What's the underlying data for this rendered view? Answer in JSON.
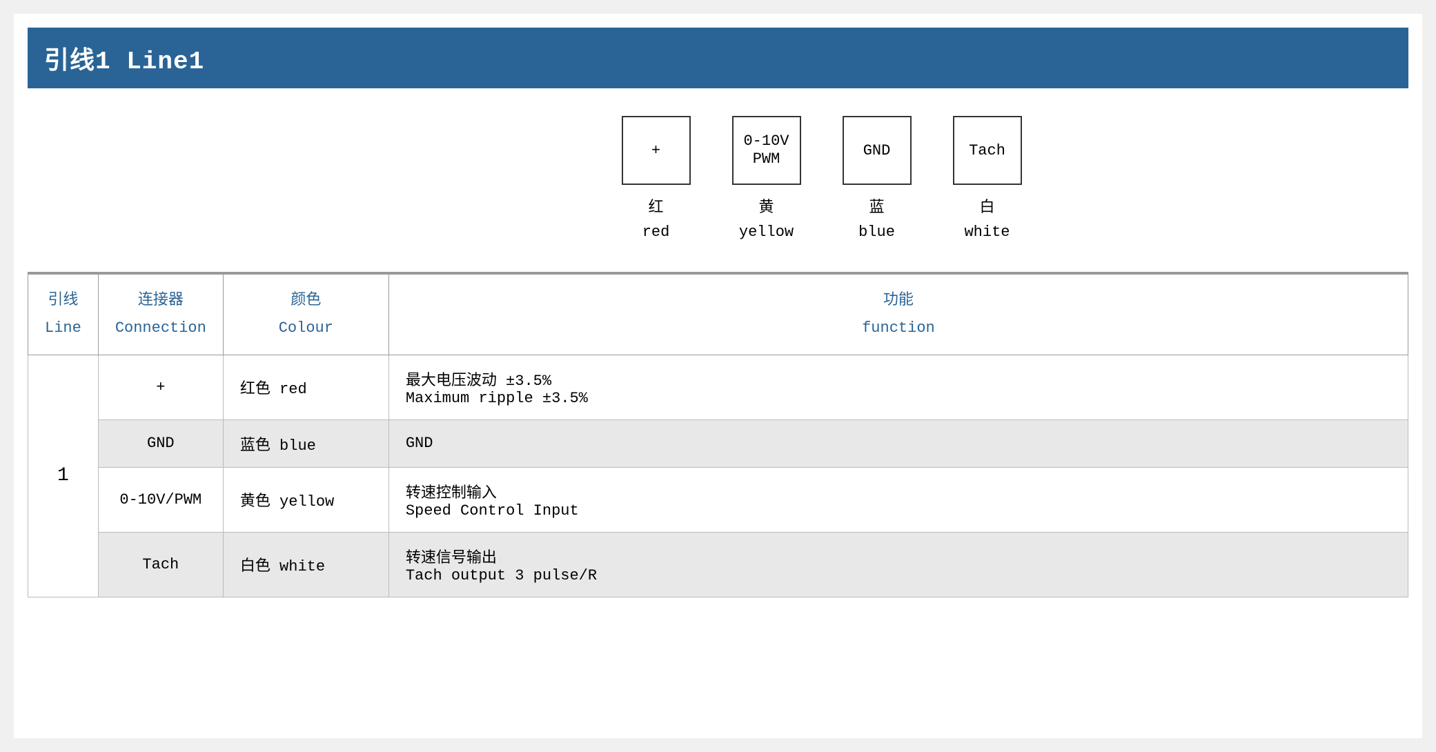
{
  "title": "引线1  Line1",
  "diagram": {
    "connectors": [
      {
        "symbol": "+",
        "chinese": "红",
        "english": "red"
      },
      {
        "symbol_line1": "0-10V",
        "symbol_line2": "PWM",
        "chinese": "黄",
        "english": "yellow"
      },
      {
        "symbol": "GND",
        "chinese": "蓝",
        "english": "blue"
      },
      {
        "symbol": "Tach",
        "chinese": "白",
        "english": "white"
      }
    ]
  },
  "table": {
    "headers": {
      "line_chinese": "引线",
      "line_english": "Line",
      "connection_chinese": "连接器",
      "connection_english": "Connection",
      "colour_chinese": "颜色",
      "colour_english": "Colour",
      "function_chinese": "功能",
      "function_english": "function"
    },
    "rows": [
      {
        "line": "1",
        "connection": "+",
        "colour": "红色 red",
        "function_chinese": "最大电压波动 ±3.5%",
        "function_english": "Maximum ripple ±3.5%",
        "shaded": false
      },
      {
        "line": "",
        "connection": "GND",
        "colour": "蓝色 blue",
        "function_chinese": "GND",
        "function_english": "",
        "shaded": true
      },
      {
        "line": "",
        "connection": "0-10V/PWM",
        "colour": "黄色 yellow",
        "function_chinese": "转速控制输入",
        "function_english": "Speed Control Input",
        "shaded": false
      },
      {
        "line": "",
        "connection": "Tach",
        "colour": "白色 white",
        "function_chinese": "转速信号输出",
        "function_english": "Tach output 3 pulse/R",
        "shaded": true
      }
    ]
  }
}
